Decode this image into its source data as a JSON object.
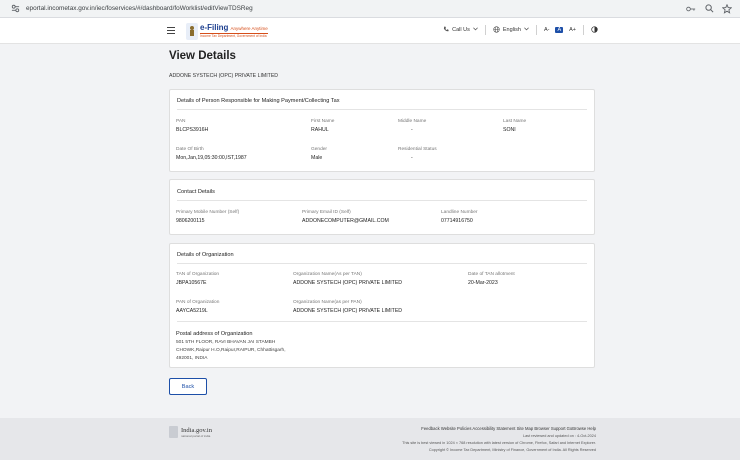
{
  "browser": {
    "url": "eportal.incometax.gov.in/iec/foservices/#/dashboard/foWorklist/editViewTDSReg"
  },
  "header": {
    "logo_title": "e-Filing",
    "logo_hindi": "Anywhere Anytime",
    "logo_subtitle": "Income Tax Department, Government of India",
    "call_us": "Call Us",
    "language": "English",
    "text_small": "A-",
    "text_normal": "A",
    "text_large": "A+"
  },
  "page": {
    "title": "View Details",
    "org_name": "ADDONE SYSTECH (OPC) PRIVATE LIMITED"
  },
  "person": {
    "section_title": "Details of Person Responsible for Making Payment/Collecting Tax",
    "pan_label": "PAN",
    "pan_value": "BLCPS3916H",
    "first_name_label": "First Name",
    "first_name_value": "RAHUL",
    "middle_name_label": "Middle Name",
    "middle_name_value": "-",
    "last_name_label": "Last Name",
    "last_name_value": "SONI",
    "dob_label": "Date Of Birth",
    "dob_value": "Mon,Jan,19,05:30:00,IST,1987",
    "gender_label": "Gender",
    "gender_value": "Male",
    "residential_label": "Residential Status",
    "residential_value": "-"
  },
  "contact": {
    "section_title": "Contact Details",
    "mobile_label": "Primary Mobile Number (Self)",
    "mobile_value": "9806200115",
    "email_label": "Primary Email ID (Self)",
    "email_value": "ADDONECOMPUTER@GMAIL.COM",
    "landline_label": "Landline Number",
    "landline_value": "07714916750"
  },
  "organization": {
    "section_title": "Details of Organization",
    "tan_label": "TAN of Organization",
    "tan_value": "JBPA10567E",
    "name_tan_label": "Organization Name(As per TAN)",
    "name_tan_value": "ADDONE SYSTECH (OPC) PRIVATE LIMITED",
    "tan_date_label": "Date of TAN allotment",
    "tan_date_value": "20-Mar-2023",
    "pan_label": "PAN of Organization",
    "pan_value": "AAYCA5219L",
    "name_pan_label": "Organization Name(as per PAN)",
    "name_pan_value": "ADDONE SYSTECH (OPC) PRIVATE LIMITED",
    "address_title": "Postal address of Organization",
    "address_lines": [
      "501 5TH FLOOR, RAVI BHAVAN JAI STAMBH",
      "CHOWK,Raipur H.O,Raipur,RAIPUR, Chhattisgarh,",
      "492001, INDIA"
    ]
  },
  "actions": {
    "back_label": "Back"
  },
  "footer": {
    "india_name": "India.gov.in",
    "india_sub": "national portal of india",
    "links": "Feedback  Website Policies  Accessibility Statement  Site Map  Browser Support  GoBrowse Help",
    "updated": "Last reviewed and updated on : 4-Oct-2024",
    "best_viewed": "This site is best viewed in 1024 × 768 resolution with latest version of Chrome, Firefox, Safari and Internet Explorer.",
    "copyright": "Copyright © Income Tax Department, Ministry of Finance, Government of India. All Rights Reserved"
  },
  "colors": {
    "accent": "#1d4fa8",
    "brand_orange": "#d64e1a",
    "page_bg": "#f2f3f5"
  }
}
